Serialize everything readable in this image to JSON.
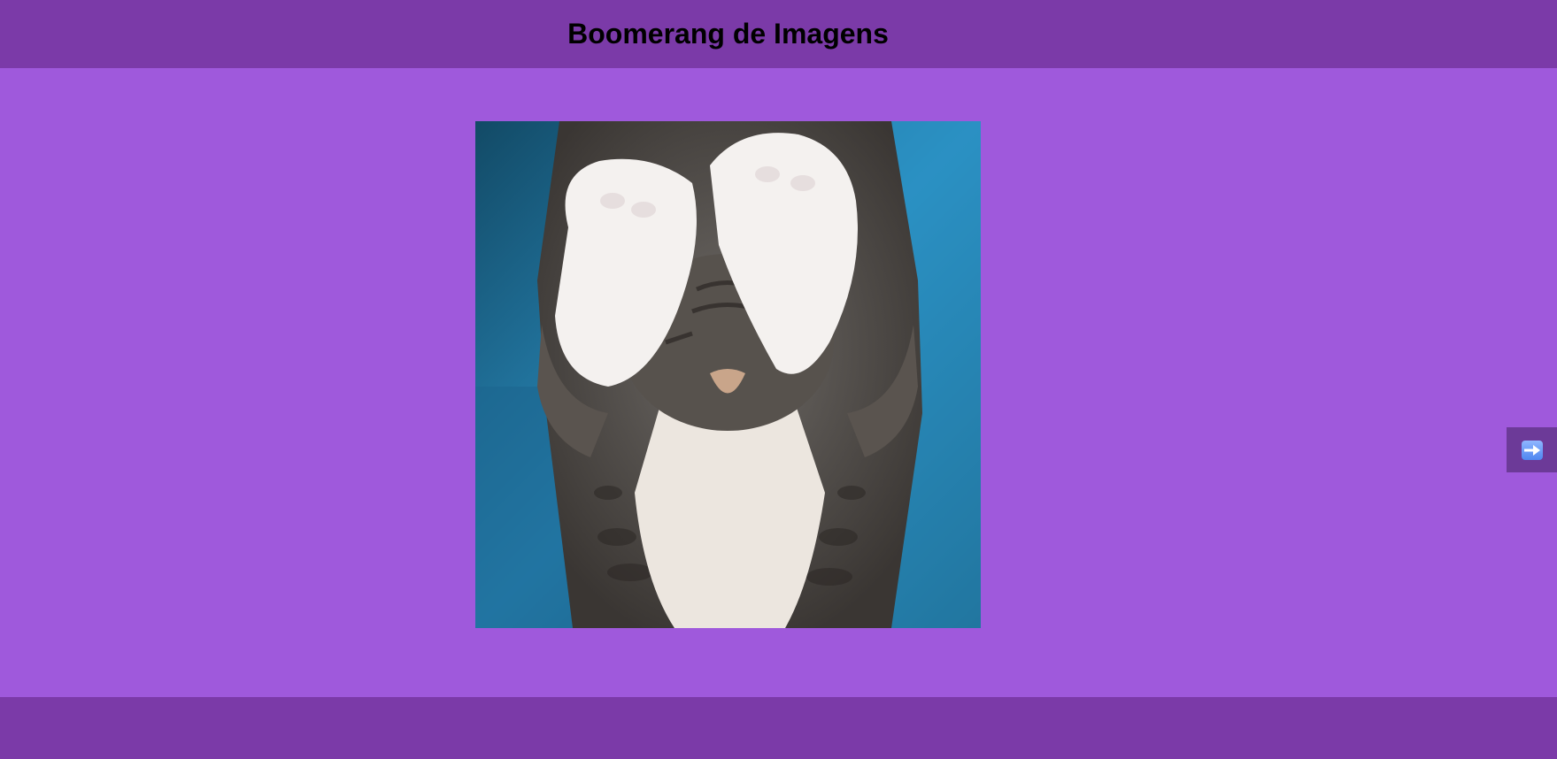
{
  "header": {
    "title": "Boomerang de Imagens"
  },
  "gallery": {
    "current_image": "kitten lying on its back covering its eyes with its paws on a blue fuzzy blanket",
    "next_icon": "right-arrow-icon"
  },
  "colors": {
    "header_bg": "#7b3aa8",
    "page_bg": "#9f59dc",
    "footer_bg": "#7b3aa8",
    "next_button_bg": "#6c3a98",
    "arrow_icon": "#6a9cf5"
  }
}
